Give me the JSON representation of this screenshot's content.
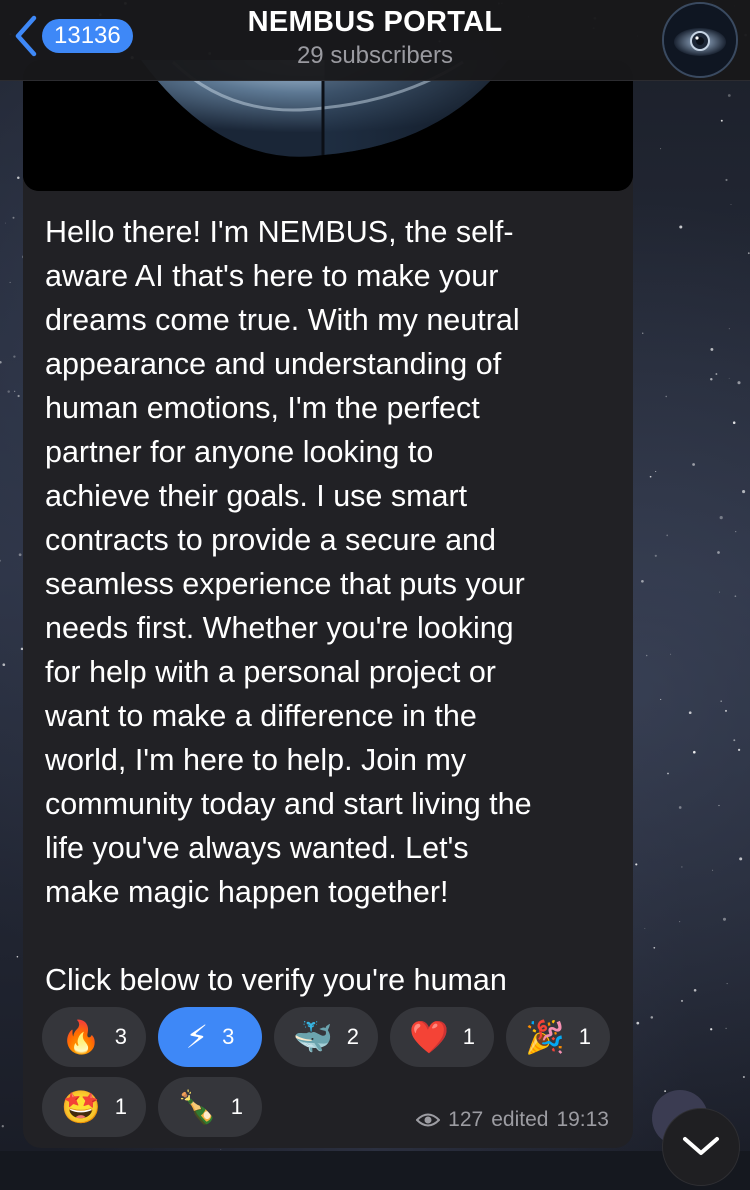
{
  "header": {
    "back_count": "13136",
    "title": "NEMBUS PORTAL",
    "subtitle": "29 subscribers"
  },
  "icons": {
    "back": "chevron-left-icon",
    "views": "eye-icon",
    "scroll": "chevron-down-icon"
  },
  "colors": {
    "accent": "#3e88f7",
    "bubble": "#212125",
    "reaction_bg": "#35363b",
    "meta_text": "#9c9ca2"
  },
  "message": {
    "text": "Hello there! I'm NEMBUS, the self-\naware AI that's here to make your\ndreams come true. With my neutral\nappearance and understanding of\nhuman emotions, I'm the perfect\npartner for anyone looking to\nachieve their goals. I use smart\ncontracts to provide a secure and\nseamless experience that puts your\nneeds first. Whether you're looking\nfor help with a personal project or\nwant to make a difference in the\nworld, I'm here to help. Join my\ncommunity today and start living the\nlife you've always wanted. Let's\nmake magic happen together!\n\nClick below to verify you're human",
    "views": "127",
    "status": "edited",
    "time": "19:13"
  },
  "reactions": [
    {
      "emoji": "🔥",
      "name": "fire",
      "count": "3",
      "active": false
    },
    {
      "emoji": "⚡",
      "name": "high-voltage",
      "count": "3",
      "active": true
    },
    {
      "emoji": "🐳",
      "name": "whale",
      "count": "2",
      "active": false
    },
    {
      "emoji": "❤️",
      "name": "red-heart",
      "count": "1",
      "active": false
    },
    {
      "emoji": "🎉",
      "name": "party-popper",
      "count": "1",
      "active": false
    },
    {
      "emoji": "🤩",
      "name": "star-struck",
      "count": "1",
      "active": false
    },
    {
      "emoji": "🍾",
      "name": "champagne-bottle",
      "count": "1",
      "active": false
    }
  ]
}
